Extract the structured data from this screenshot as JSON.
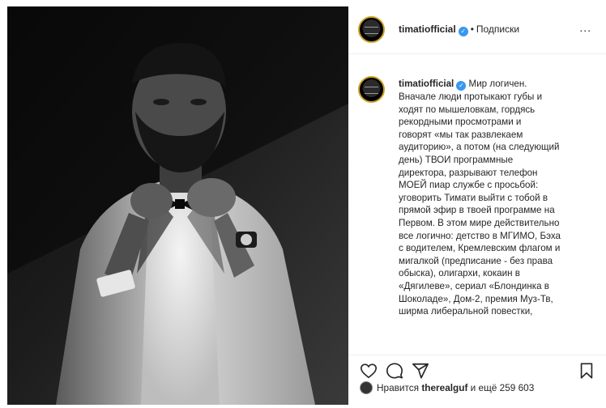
{
  "post": {
    "username": "timatiofficial",
    "follow_label": "Подписки",
    "more_label": "...",
    "caption_lines": [
      "Мир логичен.",
      "Вначале люди протыкают губы и",
      "ходят по мышеловкам, гордясь",
      "рекордными просмотрами и",
      "говорят «мы так развлекаем",
      "аудиторию», а потом (на следующий",
      "день) ТВОИ программные",
      "директора, разрывают телефон",
      "МОЕЙ пиар службе с просьбой:",
      "уговорить Тимати выйти с тобой в",
      "прямой эфир в твоей программе на",
      "Первом. В этом мире действительно",
      "все логично: детство в МГИМО, Бэха",
      "с водителем, Кремлевским флагом и",
      "мигалкой (предписание - без права",
      "обыска), олигархи, кокаин в",
      "«Дягилеве», сериал «Блондинка в",
      "Шоколаде», Дом-2, премия Муз-Тв,",
      "ширма либеральной повестки,"
    ],
    "likes": {
      "prefix": "Нравится",
      "user": "therealguf",
      "suffix": "и ещё 259 603"
    }
  },
  "icons": {
    "verified": "verified-badge-icon",
    "like": "heart-icon",
    "comment": "comment-icon",
    "share": "share-icon",
    "save": "bookmark-icon"
  },
  "colors": {
    "verified_blue": "#3897f0",
    "text": "#262626",
    "divider": "#efefef"
  }
}
